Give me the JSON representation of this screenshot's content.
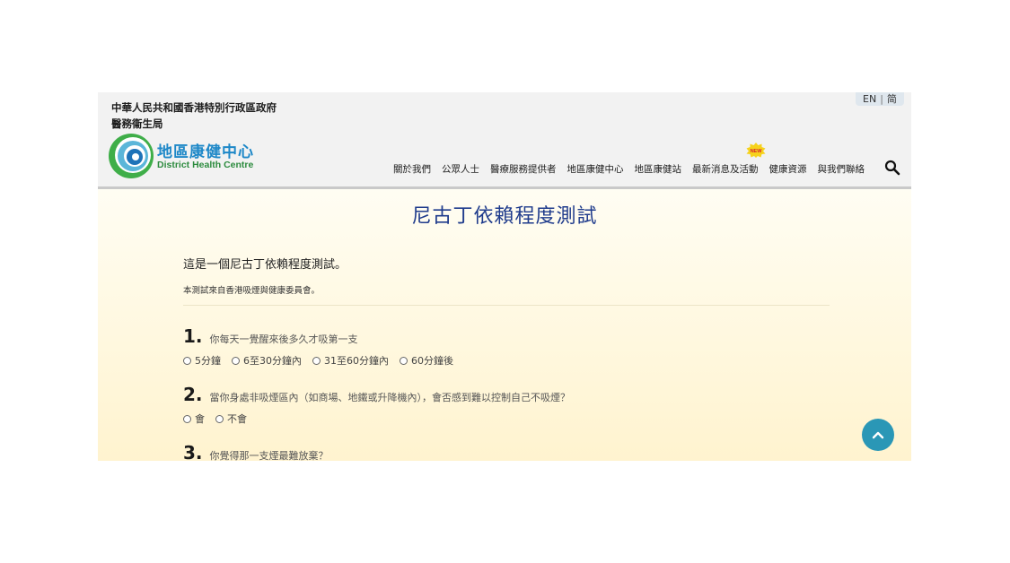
{
  "header": {
    "gov_line1": "中華人民共和國香港特別行政區政府",
    "gov_line2": "醫務衞生局",
    "logo_zh": "地區康健中心",
    "logo_en": "District Health Centre",
    "lang_en": "EN",
    "lang_sep": "|",
    "lang_sc": "简",
    "new_badge": "NEW",
    "nav": [
      "關於我們",
      "公眾人士",
      "醫療服務提供者",
      "地區康健中心",
      "地區康健站",
      "最新消息及活動",
      "健康資源",
      "與我們聯絡"
    ],
    "icons": {
      "search": "search-icon",
      "logo": "district-health-centre-logo",
      "to_top": "chevron-up-icon"
    }
  },
  "page": {
    "title": "尼古丁依賴程度測試",
    "intro": "這是一個尼古丁依賴程度測試。",
    "source": "本測試來自香港吸煙與健康委員會。"
  },
  "questions": [
    {
      "num": "1.",
      "text": "你每天一覺醒來後多久才吸第一支",
      "options": [
        "5分鐘",
        "6至30分鐘內",
        "31至60分鐘內",
        "60分鐘後"
      ]
    },
    {
      "num": "2.",
      "text": "當你身處非吸煙區內（如商場、地鐵或升降機內），會否感到難以控制自己不吸煙？",
      "options": [
        "會",
        "不會"
      ]
    },
    {
      "num": "3.",
      "text": "你覺得那一支煙最難放棄？",
      "options": []
    }
  ],
  "colors": {
    "title": "#1f3b8c",
    "logo_blue": "#1e88c8",
    "logo_green": "#2c8b3e",
    "to_top": "#2a97b6",
    "header_bg": "#f2f2f2"
  }
}
